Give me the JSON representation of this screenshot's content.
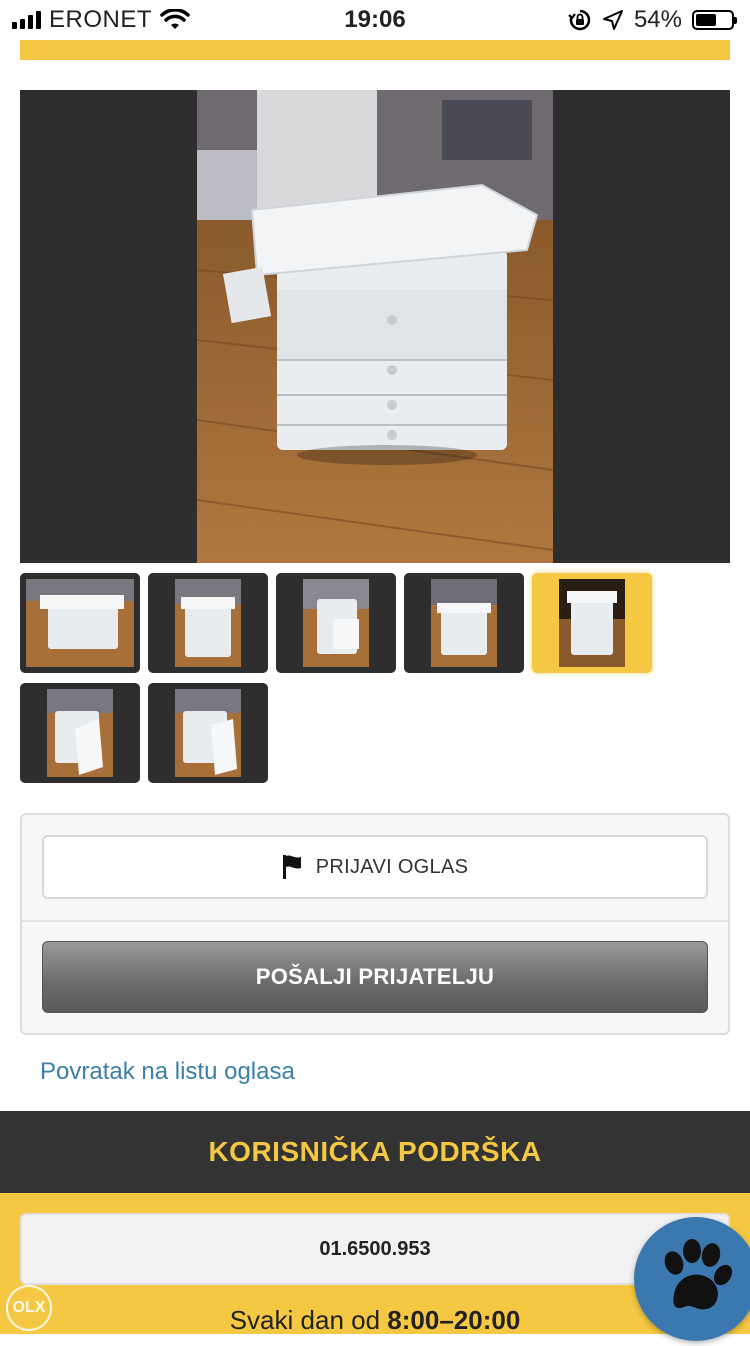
{
  "status_bar": {
    "carrier": "ERONET",
    "time": "19:06",
    "battery": "54%"
  },
  "gallery": {
    "main_image": "changing-table-photo",
    "thumbnail_count": 7,
    "active_thumbnail": 5
  },
  "actions": {
    "report_label": "PRIJAVI OGLAS",
    "send_label": "POŠALJI PRIJATELJU"
  },
  "back_link": "Povratak na listu oglasa",
  "support": {
    "title": "KORISNIČKA PODRŠKA",
    "phone": "01.6500.953",
    "hours_prefix": "Svaki dan od",
    "hours_value": "8:00–20:00"
  },
  "watermark": "OLX",
  "colors": {
    "accent": "#f4c842",
    "dark": "#333333",
    "link": "#3a7fa8",
    "paw": "#3c78b0"
  }
}
